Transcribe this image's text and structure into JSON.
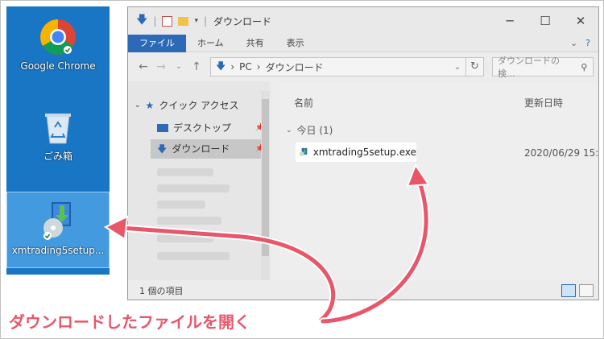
{
  "desktop": {
    "icons": [
      {
        "label": "Google Chrome"
      },
      {
        "label": "ごみ箱"
      },
      {
        "label": "xmtrading5setup..."
      }
    ]
  },
  "window": {
    "title": "ダウンロード",
    "controls": {
      "minimize": "─",
      "maximize": "☐",
      "close": "✕"
    },
    "ribbon": {
      "tabs": [
        "ファイル",
        "ホーム",
        "共有",
        "表示"
      ]
    },
    "address": {
      "segments": [
        "PC",
        "ダウンロード"
      ]
    },
    "search": {
      "placeholder": "ダウンロードの検..."
    },
    "nav": {
      "quick_access": "クイック アクセス",
      "desktop": "デスクトップ",
      "downloads": "ダウンロード"
    },
    "files": {
      "col_name": "名前",
      "col_date": "更新日時",
      "group_label": "今日 (1)",
      "items": [
        {
          "name": "xmtrading5setup.exe",
          "date": "2020/06/29 15:"
        }
      ]
    },
    "status": {
      "count": "1 個の項目"
    }
  },
  "caption": "ダウンロードしたファイルを開く",
  "colors": {
    "accent": "#e8566a",
    "desktop_bg": "#1976c4",
    "ribbon_active": "#2c6ab8"
  }
}
